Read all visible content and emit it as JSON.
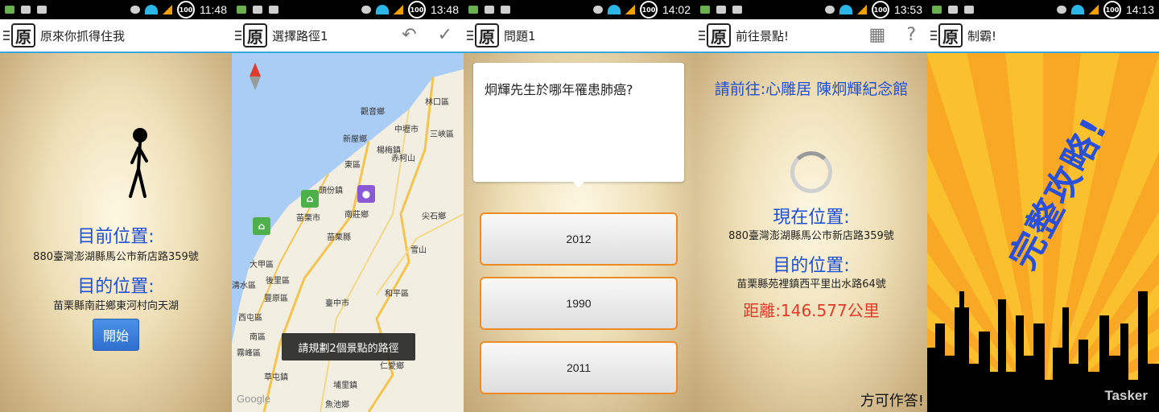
{
  "screens": [
    {
      "status": {
        "time": "11:48",
        "battery": "100"
      },
      "title": "原來你抓得住我",
      "current_label": "目前位置:",
      "current_value": "880臺灣澎湖縣馬公市新店路359號",
      "dest_label": "目的位置:",
      "dest_value": "苗栗縣南莊鄉東河村向天湖",
      "start_button": "開始"
    },
    {
      "status": {
        "time": "13:48",
        "battery": "100"
      },
      "title": "選擇路徑1",
      "undo_icon": "undo-icon",
      "confirm_icon": "check-icon",
      "map_labels": [
        "林口區",
        "觀音鄉",
        "中壢市",
        "三峽區",
        "新屋鄉",
        "楊梅鎮",
        "東區",
        "頭份鎮",
        "苗栗市",
        "南莊鄉",
        "尖石鄉",
        "苗栗縣",
        "雪山",
        "大甲區",
        "後里區",
        "清水區",
        "豐原區",
        "和平區",
        "臺中市",
        "西屯區",
        "南區",
        "霧峰區",
        "草屯鎮",
        "埔里鎮",
        "魚池鄉",
        "仁愛鄉",
        "赤柯山"
      ],
      "toast": "請規劃2個景點的路徑",
      "attribution": "Google"
    },
    {
      "status": {
        "time": "14:02",
        "battery": "100"
      },
      "title": "問題1",
      "question": "炯輝先生於哪年罹患肺癌?",
      "answers": [
        "2012",
        "1990",
        "2011"
      ]
    },
    {
      "status": {
        "time": "13:53",
        "battery": "100"
      },
      "title": "前往景點!",
      "map_icon": "map-icon",
      "help_icon": "help-icon",
      "go_to": "請前往:心雕居 陳炯輝紀念館",
      "current_label": "現在位置:",
      "current_value": "880臺灣澎湖縣馬公市新店路359號",
      "dest_label": "目的位置:",
      "dest_value": "苗栗縣苑裡鎮西平里出水路64號",
      "distance": "距離:146.577公里",
      "after_arrive": "方可作答!"
    },
    {
      "status": {
        "time": "14:13",
        "battery": "100"
      },
      "title": "制霸!",
      "banner": "完整攻略!",
      "watermark": "Tasker"
    }
  ],
  "colors": {
    "accent_blue": "#1f4fd6",
    "action_bar_line": "#3aa6dc",
    "answer_border": "#f08a24",
    "distance_red": "#e03b2a"
  }
}
